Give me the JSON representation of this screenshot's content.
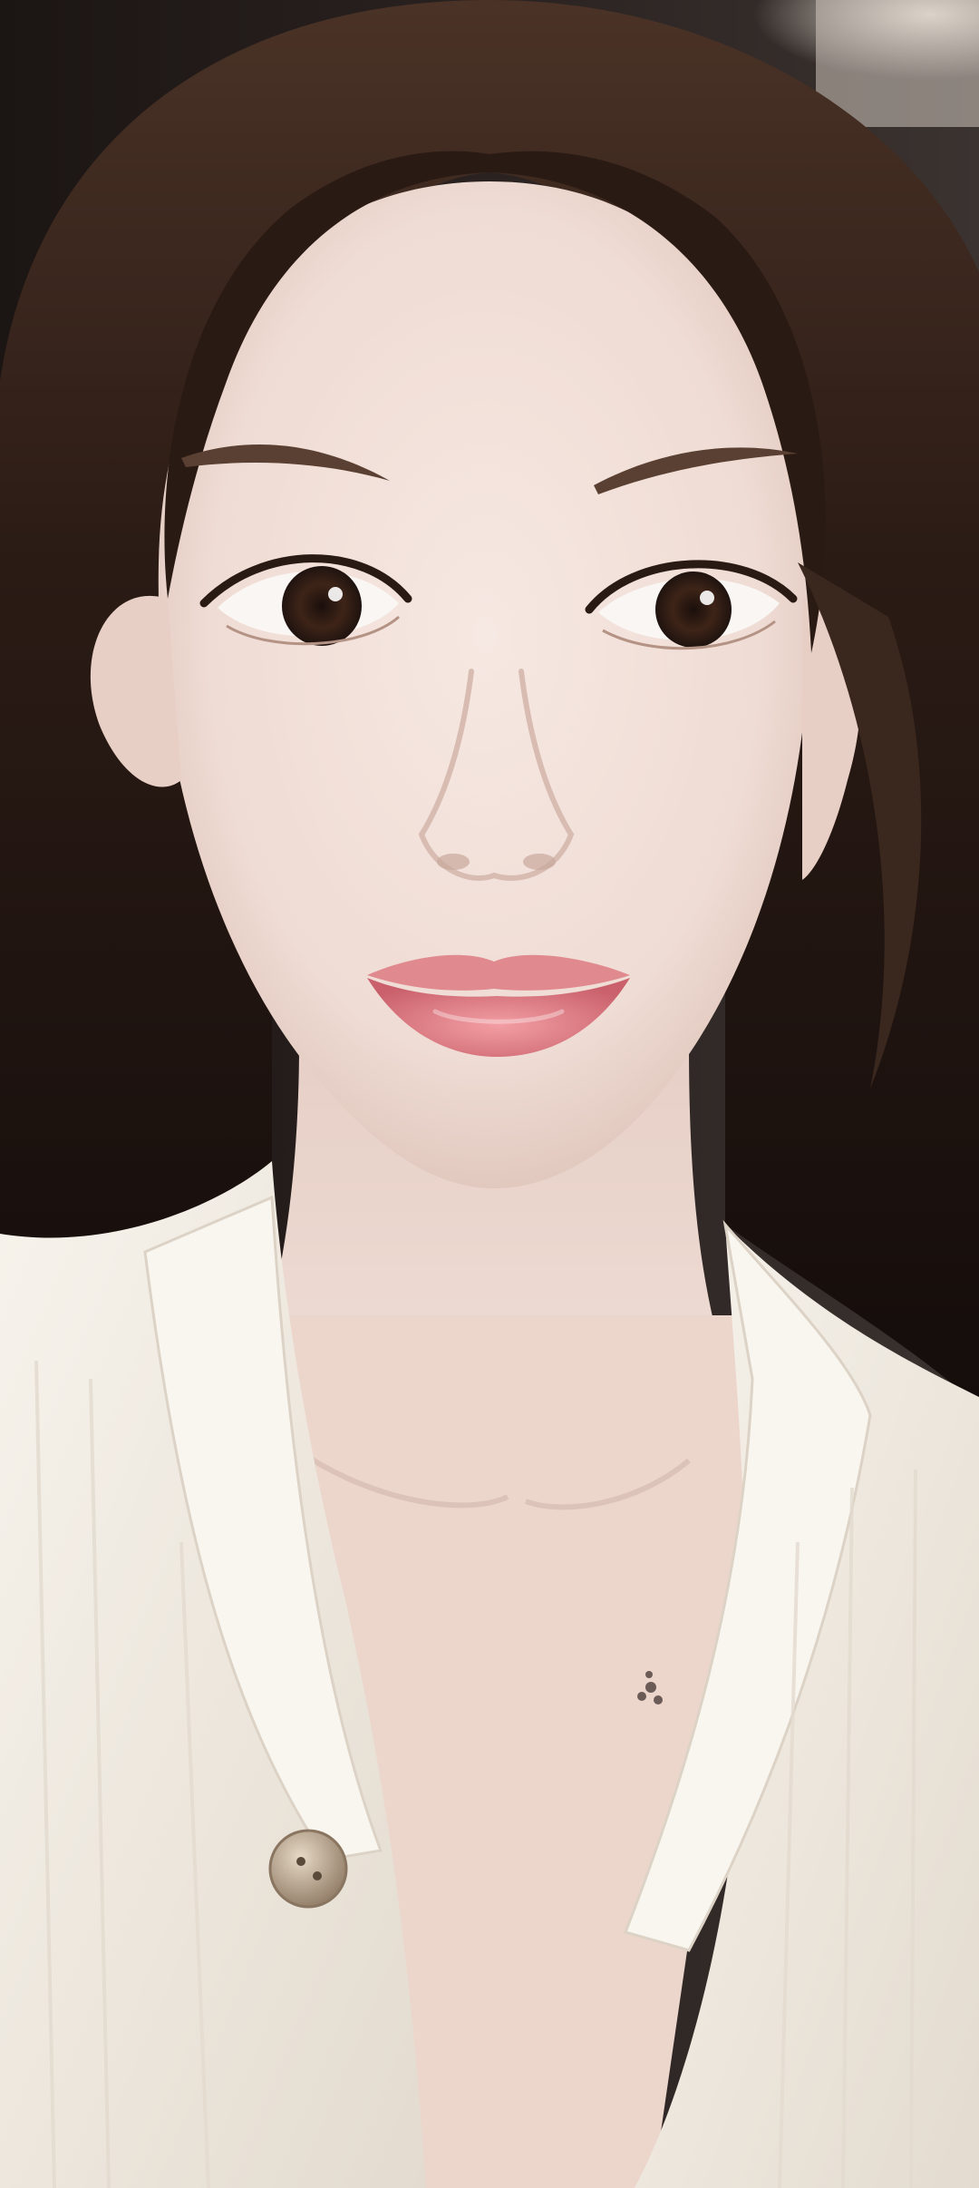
{
  "photo": {
    "subject": "selfie-portrait",
    "palette": {
      "background_dark": "#1a1412",
      "background_light": "#cfc6bd",
      "hair": "#2a1a14",
      "hair_highlight": "#5a4032",
      "skin": "#f1dfd8",
      "skin_shadow": "#dcc1b6",
      "lips": "#d9737b",
      "iris": "#3a221a",
      "blouse": "#f4efe6",
      "blouse_shadow": "#d9d0c3",
      "button": "#b8a58f"
    }
  }
}
